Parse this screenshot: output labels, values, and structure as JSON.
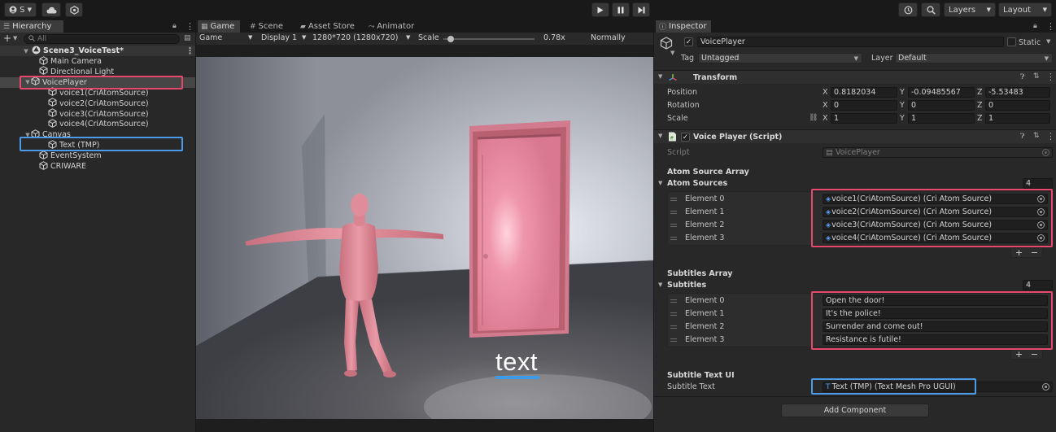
{
  "toolbar": {
    "account_label": "S",
    "layers_label": "Layers",
    "layout_label": "Layout"
  },
  "hierarchy": {
    "tab_label": "Hierarchy",
    "search_placeholder": "All",
    "scene_name": "Scene3_VoiceTest*",
    "items": [
      {
        "label": "Main Camera"
      },
      {
        "label": "Directional Light"
      },
      {
        "label": "VoicePlayer"
      },
      {
        "label": "voice1(CriAtomSource)"
      },
      {
        "label": "voice2(CriAtomSource)"
      },
      {
        "label": "voice3(CriAtomSource)"
      },
      {
        "label": "voice4(CriAtomSource)"
      },
      {
        "label": "Canvas"
      },
      {
        "label": "Text (TMP)"
      },
      {
        "label": "EventSystem"
      },
      {
        "label": "CRIWARE"
      }
    ]
  },
  "game": {
    "tabs": [
      {
        "label": "Game"
      },
      {
        "label": "Scene"
      },
      {
        "label": "Asset Store"
      },
      {
        "label": "Animator"
      }
    ],
    "view_mode": "Game",
    "display": "Display 1",
    "resolution": "1280*720 (1280x720)",
    "scale_label": "Scale",
    "scale_value": "0.78x",
    "scale_fraction": 0.05,
    "play_focus": "Normally",
    "subtitle_text": "text"
  },
  "inspector": {
    "tab_label": "Inspector",
    "object_name": "VoicePlayer",
    "static_label": "Static",
    "tag_label": "Tag",
    "tag_value": "Untagged",
    "layer_label": "Layer",
    "layer_value": "Default",
    "transform": {
      "title": "Transform",
      "position_label": "Position",
      "rotation_label": "Rotation",
      "scale_label": "Scale",
      "axis_x": "X",
      "axis_y": "Y",
      "axis_z": "Z",
      "position": [
        "0.8182034",
        "-0.09485567",
        "-5.53483"
      ],
      "rotation": [
        "0",
        "0",
        "0"
      ],
      "scale": [
        "1",
        "1",
        "1"
      ]
    },
    "script_component": {
      "title": "Voice Player (Script)",
      "script_label": "Script",
      "script_value": "VoicePlayer",
      "atom_header": "Atom Source Array",
      "atom_list_label": "Atom Sources",
      "atom_count": "4",
      "atom_elements": [
        {
          "label": "Element 0",
          "value": "voice1(CriAtomSource) (Cri Atom Source)"
        },
        {
          "label": "Element 1",
          "value": "voice2(CriAtomSource) (Cri Atom Source)"
        },
        {
          "label": "Element 2",
          "value": "voice3(CriAtomSource) (Cri Atom Source)"
        },
        {
          "label": "Element 3",
          "value": "voice4(CriAtomSource) (Cri Atom Source)"
        }
      ],
      "subtitles_header": "Subtitles Array",
      "subtitles_list_label": "Subtitles",
      "subtitles_count": "4",
      "subtitle_elements": [
        {
          "label": "Element 0",
          "value": "Open the door!"
        },
        {
          "label": "Element 1",
          "value": "It's the police!"
        },
        {
          "label": "Element 2",
          "value": "Surrender and come out!"
        },
        {
          "label": "Element 3",
          "value": "Resistance is futile!"
        }
      ],
      "subtitle_ui_header": "Subtitle Text UI",
      "subtitle_text_label": "Subtitle Text",
      "subtitle_text_value": "Text (TMP) (Text Mesh Pro UGUI)"
    },
    "add_component_label": "Add Component",
    "plus": "+",
    "minus": "−"
  },
  "colors": {
    "highlight_pink": "#e8476e",
    "highlight_blue": "#4a9be8",
    "subtitle_underline": "#3c9ae8"
  }
}
